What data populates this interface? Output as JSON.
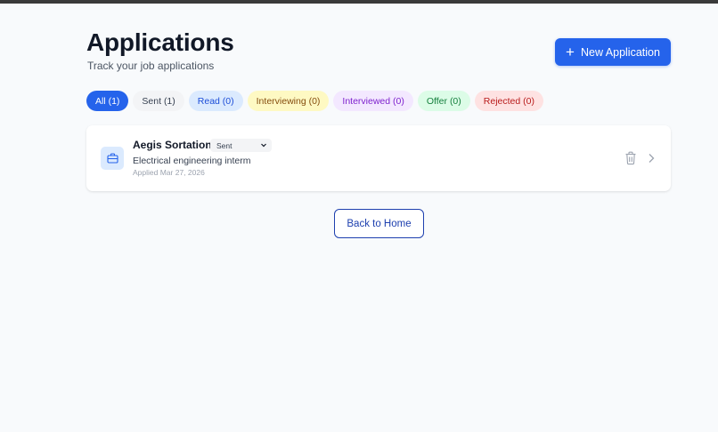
{
  "header": {
    "title": "Applications",
    "subtitle": "Track your job applications",
    "new_button_label": "New Application",
    "new_button_icon": "plus-icon"
  },
  "filters": [
    {
      "label": "All (1)",
      "active": true
    },
    {
      "label": "Sent (1)",
      "active": false
    },
    {
      "label": "Read (0)",
      "active": false
    },
    {
      "label": "Interviewing (0)",
      "active": false
    },
    {
      "label": "Interviewed (0)",
      "active": false
    },
    {
      "label": "Offer (0)",
      "active": false
    },
    {
      "label": "Rejected (0)",
      "active": false
    }
  ],
  "applications": [
    {
      "company": "Aegis Sortation",
      "status": "Sent",
      "position": "Electrical engineering interm",
      "applied": "Applied Mar 27, 2026",
      "icon": "briefcase-icon"
    }
  ],
  "footer": {
    "back_label": "Back to Home"
  },
  "colors": {
    "primary": "#2563eb",
    "background": "#f8fafc",
    "card": "#ffffff",
    "read": "#dbeafe",
    "interviewing": "#fef9c3",
    "interviewed": "#f3e8ff",
    "offer": "#dcfce7",
    "rejected": "#fee2e2"
  }
}
